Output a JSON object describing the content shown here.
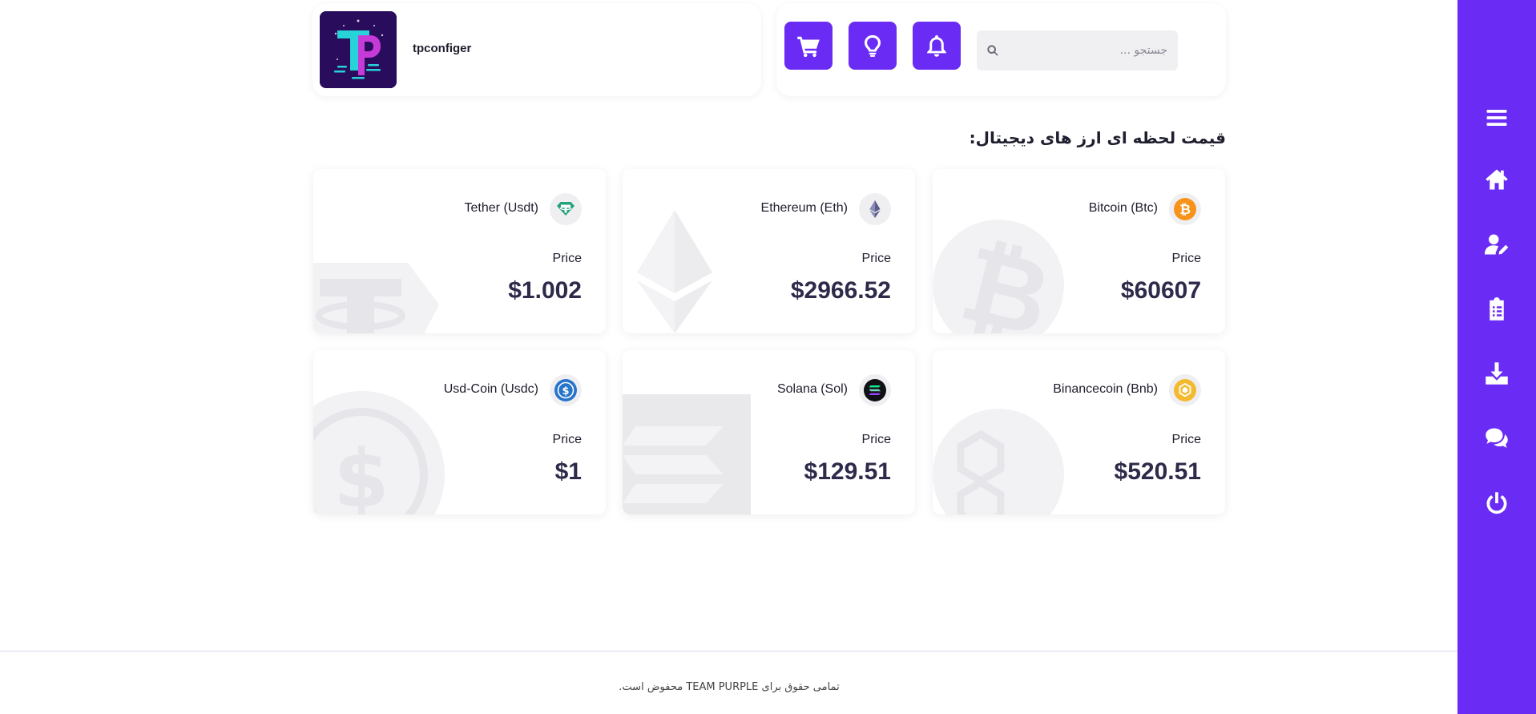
{
  "header": {
    "username": "tpconfiger",
    "search": {
      "placeholder": "جستجو ..."
    }
  },
  "section_title": "قیمت لحظه ای ارز های دیجیتال:",
  "coins": [
    {
      "name": "Bitcoin (Btc)",
      "price_label": "Price",
      "price": "$60607",
      "color": "#f7931a",
      "icon": "bitcoin-icon"
    },
    {
      "name": "Ethereum (Eth)",
      "price_label": "Price",
      "price": "$2966.52",
      "color": "#627eea",
      "icon": "ethereum-icon"
    },
    {
      "name": "Tether (Usdt)",
      "price_label": "Price",
      "price": "$1.002",
      "color": "#26a17b",
      "icon": "tether-icon"
    },
    {
      "name": "Binancecoin (Bnb)",
      "price_label": "Price",
      "price": "$520.51",
      "color": "#f3ba2f",
      "icon": "bnb-icon"
    },
    {
      "name": "Solana (Sol)",
      "price_label": "Price",
      "price": "$129.51",
      "color": "#14f195",
      "icon": "solana-icon"
    },
    {
      "name": "Usd-Coin (Usdc)",
      "price_label": "Price",
      "price": "$1",
      "color": "#2775ca",
      "icon": "usdc-icon"
    }
  ],
  "footer": {
    "text": "تمامی حقوق برای TEAM PURPLE محفوض است."
  },
  "colors": {
    "accent": "#6a2bf5",
    "title": "#1e1e2e",
    "price": "#2d2a4a"
  }
}
